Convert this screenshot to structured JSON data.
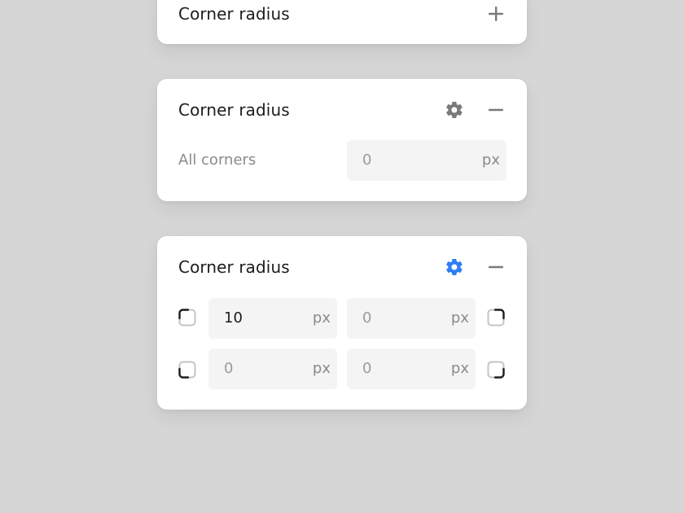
{
  "colors": {
    "background": "#d6d6d6",
    "card": "#ffffff",
    "field": "#f4f4f4",
    "icon_gray": "#7a7a7a",
    "accent_blue": "#2f7df6"
  },
  "cards": [
    {
      "title": "Corner radius",
      "state": "collapsed",
      "icons": [
        "plus-icon"
      ]
    },
    {
      "title": "Corner radius",
      "state": "expanded-uniform",
      "icons": [
        "gear-icon",
        "minus-icon"
      ],
      "row_label": "All corners",
      "field": {
        "value": "0",
        "unit": "px"
      }
    },
    {
      "title": "Corner radius",
      "state": "expanded-individual",
      "icons": [
        "gear-icon-active",
        "minus-icon"
      ],
      "fields": {
        "top_left": {
          "value": "10",
          "unit": "px"
        },
        "top_right": {
          "value": "0",
          "unit": "px"
        },
        "bottom_left": {
          "value": "0",
          "unit": "px"
        },
        "bottom_right": {
          "value": "0",
          "unit": "px"
        }
      }
    }
  ]
}
